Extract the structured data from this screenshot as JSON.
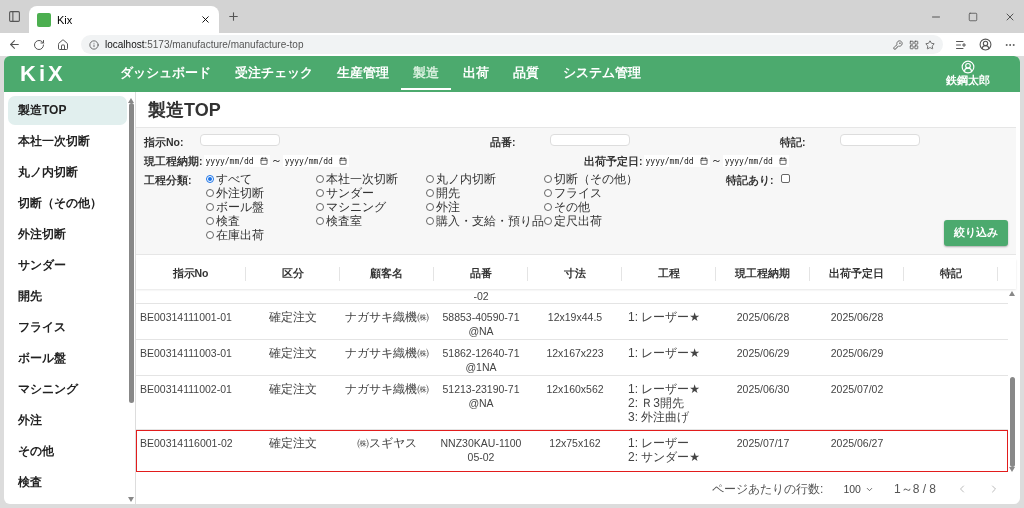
{
  "browser": {
    "tab_title": "Kix",
    "url_host": "localhost",
    "url_rest": ":5173/manufacture/manufacture-top"
  },
  "header": {
    "logo": "KiX",
    "nav": [
      {
        "label": "ダッシュボード",
        "selected": false
      },
      {
        "label": "受注チェック",
        "selected": false
      },
      {
        "label": "生産管理",
        "selected": false
      },
      {
        "label": "製造",
        "selected": true
      },
      {
        "label": "出荷",
        "selected": false
      },
      {
        "label": "品質",
        "selected": false
      },
      {
        "label": "システム管理",
        "selected": false
      }
    ],
    "user": "鉄鋼太郎"
  },
  "sidebar": {
    "items": [
      {
        "label": "製造TOP",
        "selected": true
      },
      {
        "label": "本社一次切断",
        "selected": false
      },
      {
        "label": "丸ノ内切断",
        "selected": false
      },
      {
        "label": "切断（その他）",
        "selected": false
      },
      {
        "label": "外注切断",
        "selected": false
      },
      {
        "label": "サンダー",
        "selected": false
      },
      {
        "label": "開先",
        "selected": false
      },
      {
        "label": "フライス",
        "selected": false
      },
      {
        "label": "ボール盤",
        "selected": false
      },
      {
        "label": "マシニング",
        "selected": false
      },
      {
        "label": "外注",
        "selected": false
      },
      {
        "label": "その他",
        "selected": false
      },
      {
        "label": "検査",
        "selected": false
      }
    ]
  },
  "page_title": "製造TOP",
  "filters": {
    "order_no": {
      "label": "指示No:"
    },
    "part_no": {
      "label": "品番:"
    },
    "note": {
      "label": "特記:"
    },
    "due_range": {
      "label": "現工程納期:",
      "from": "yyyy/mm/dd",
      "sep": "～",
      "to": "yyyy/mm/dd"
    },
    "ship_range": {
      "label": "出荷予定日:",
      "from": "yyyy/mm/dd",
      "sep": "～",
      "to": "yyyy/mm/dd"
    },
    "process": {
      "label": "工程分類:",
      "options": [
        {
          "label": "すべて",
          "selected": true
        },
        {
          "label": "本社一次切断",
          "selected": false
        },
        {
          "label": "丸ノ内切断",
          "selected": false
        },
        {
          "label": "切断（その他）",
          "selected": false
        },
        {
          "label": "外注切断",
          "selected": false
        },
        {
          "label": "サンダー",
          "selected": false
        },
        {
          "label": "開先",
          "selected": false
        },
        {
          "label": "フライス",
          "selected": false
        },
        {
          "label": "ボール盤",
          "selected": false
        },
        {
          "label": "マシニング",
          "selected": false
        },
        {
          "label": "外注",
          "selected": false
        },
        {
          "label": "その他",
          "selected": false
        },
        {
          "label": "検査",
          "selected": false
        },
        {
          "label": "検査室",
          "selected": false
        },
        {
          "label": "購入・支給・預り品",
          "selected": false
        },
        {
          "label": "定尺出荷",
          "selected": false
        },
        {
          "label": "在庫出荷",
          "selected": false
        }
      ]
    },
    "has_note": {
      "label": "特記あり:",
      "checked": false
    },
    "submit": "絞り込み"
  },
  "table": {
    "columns": [
      "指示No",
      "区分",
      "顧客名",
      "品番",
      "寸法",
      "工程",
      "現工程納期",
      "出荷予定日",
      "特記"
    ],
    "partial_row": {
      "part_no": "-02"
    },
    "rows": [
      {
        "order_no": "BE00314111001-01",
        "type": "確定注文",
        "customer": "ナガサキ織機㈱",
        "part_no": "58853-40590-71@NA",
        "size": "12x19x44.5",
        "processes": [
          "1: レーザー★"
        ],
        "due": "2025/06/28",
        "ship": "2025/06/28",
        "highlighted": false
      },
      {
        "order_no": "BE00314111003-01",
        "type": "確定注文",
        "customer": "ナガサキ織機㈱",
        "part_no": "51862-12640-71@1NA",
        "size": "12x167x223",
        "processes": [
          "1: レーザー★"
        ],
        "due": "2025/06/29",
        "ship": "2025/06/29",
        "highlighted": false
      },
      {
        "order_no": "BE00314111002-01",
        "type": "確定注文",
        "customer": "ナガサキ織機㈱",
        "part_no": "51213-23190-71@NA",
        "size": "12x160x562",
        "processes": [
          "1: レーザー★",
          "2: Ｒ3開先",
          "3: 外注曲げ"
        ],
        "due": "2025/06/30",
        "ship": "2025/07/02",
        "highlighted": false
      },
      {
        "order_no": "BE00314116001-02",
        "type": "確定注文",
        "customer": "㈱スギヤス",
        "part_no": "NNZ30KAU-110005-02",
        "size": "12x75x162",
        "processes": [
          "1: レーザー",
          "2: サンダー★"
        ],
        "due": "2025/07/17",
        "ship": "2025/06/27",
        "highlighted": true
      }
    ]
  },
  "pagination": {
    "rows_label": "ページあたりの行数:",
    "rows_value": "100",
    "range": "1～8 / 8"
  }
}
